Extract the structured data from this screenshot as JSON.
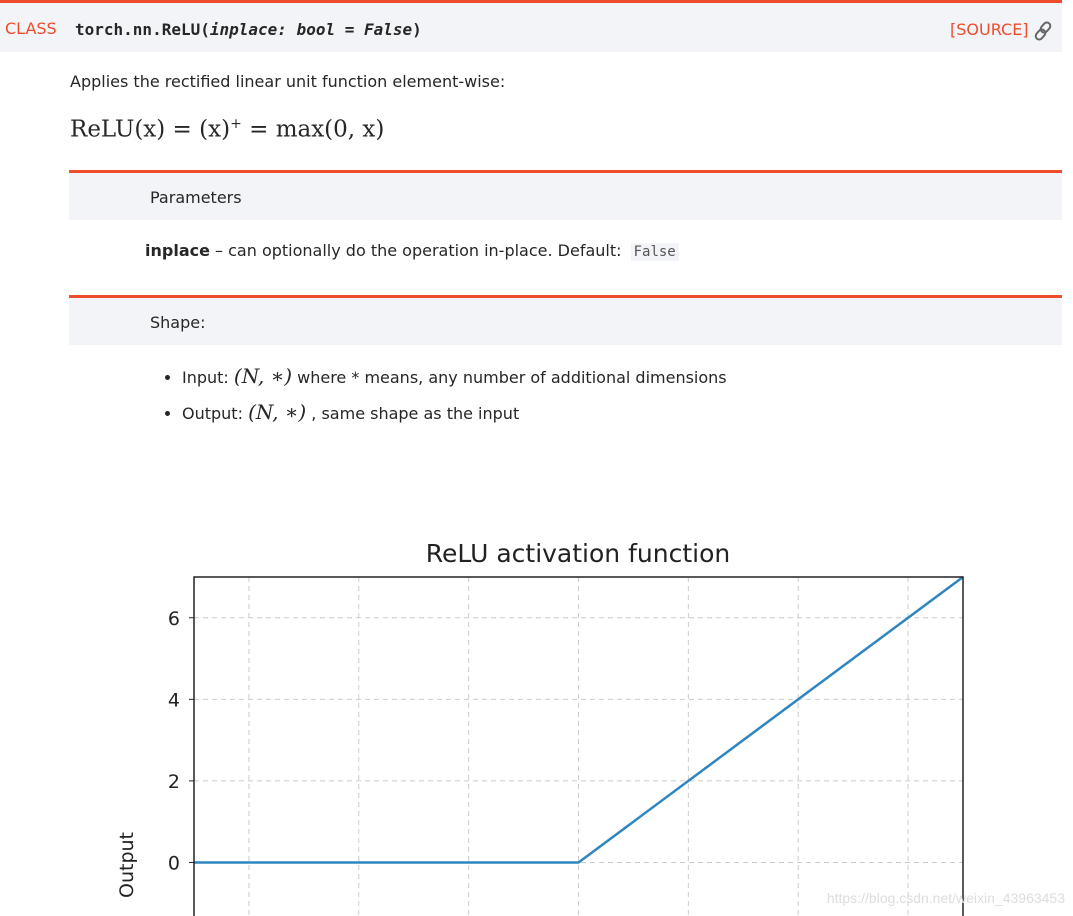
{
  "header": {
    "class_label": "CLASS",
    "signature_name": "torch.nn.ReLU(",
    "signature_args": "inplace: bool = False",
    "signature_close": ")",
    "source_label": "[SOURCE]",
    "link_icon": "link-icon"
  },
  "description": "Applies the rectified linear unit function element-wise:",
  "formula": {
    "lhs": "ReLU(x) = (x)",
    "sup": "+",
    "rhs": " = max(0, x)"
  },
  "parameters": {
    "heading": "Parameters",
    "name": "inplace",
    "text": " – can optionally do the operation in-place. Default: ",
    "default": "False"
  },
  "shape": {
    "heading": "Shape:",
    "items": [
      {
        "label": "Input: ",
        "math": "(N, ∗)",
        "text": " where * means, any number of additional dimensions"
      },
      {
        "label": "Output: ",
        "math": "(N, ∗)",
        "text": " , same shape as the input"
      }
    ]
  },
  "watermark": "https://blog.csdn.net/weixin_43963453",
  "colors": {
    "accent": "#ee4c2c",
    "band": "#f3f4f7",
    "line": "#2e86c1"
  },
  "chart_data": {
    "type": "line",
    "title": "ReLU activation function",
    "ylabel": "Output",
    "xlabel": "",
    "x": [
      -7,
      0,
      7
    ],
    "y": [
      0,
      0,
      7
    ],
    "xlim": [
      -7,
      7
    ],
    "ylim": [
      -2,
      7
    ],
    "xticks": [
      -6,
      -4,
      -2,
      0,
      2,
      4,
      6
    ],
    "yticks": [
      0,
      2,
      4,
      6
    ],
    "ytick_labels": [
      "0",
      "2",
      "4",
      "6"
    ],
    "grid": true,
    "grid_style": "dashed"
  }
}
